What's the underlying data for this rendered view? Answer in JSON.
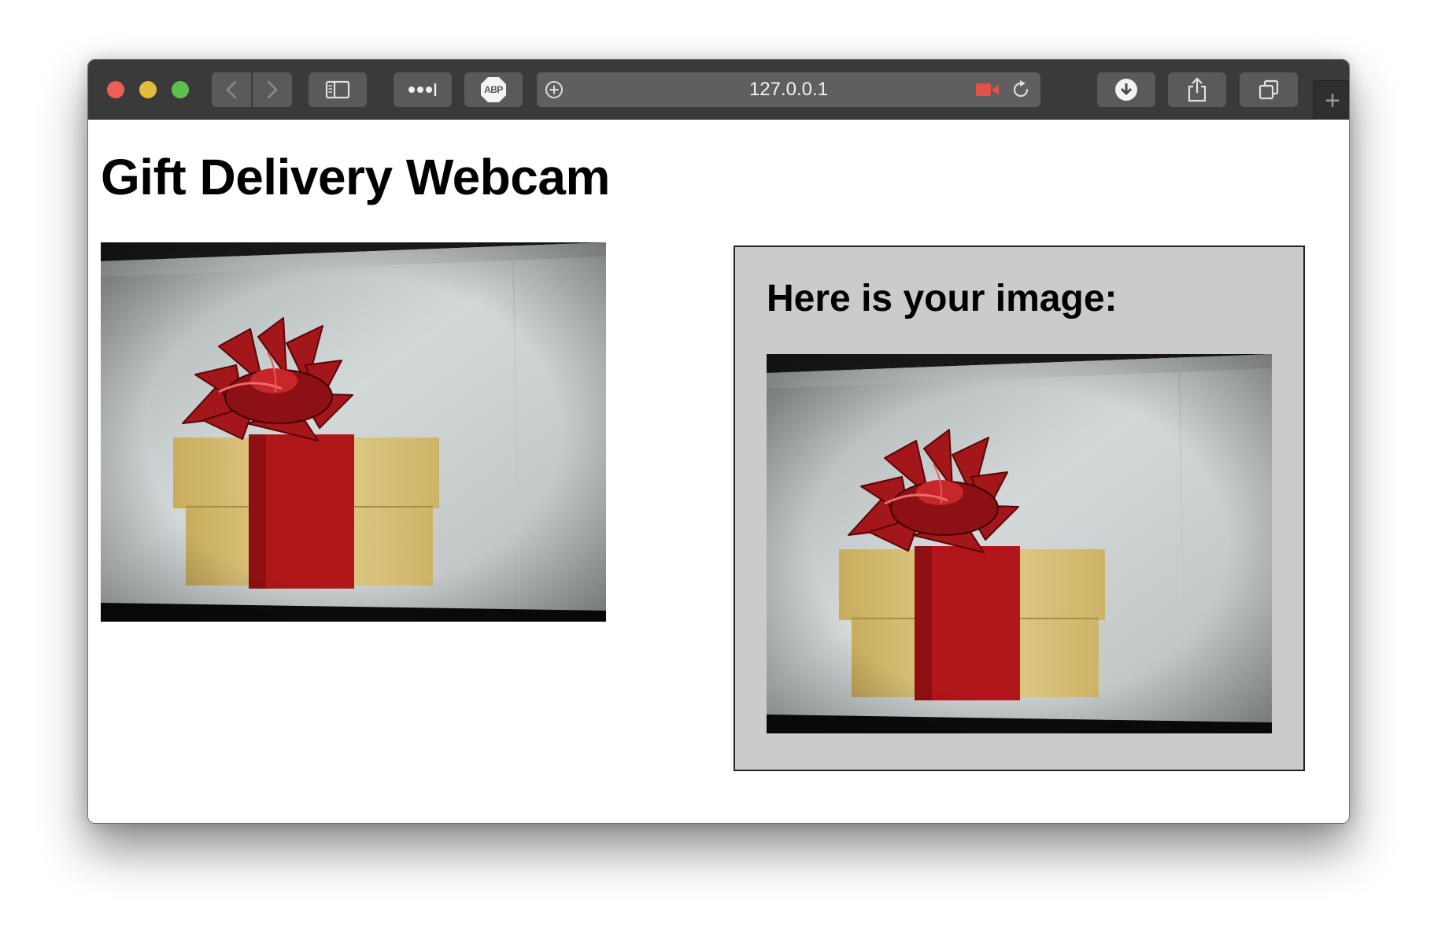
{
  "browser": {
    "address": "127.0.0.1",
    "new_tab_symbol": "+",
    "toolbar_icons": [
      "back-icon",
      "forward-icon",
      "sidebar-icon",
      "reader-icon",
      "adblock-icon",
      "add-icon",
      "camera-icon",
      "reload-icon",
      "download-icon",
      "share-icon",
      "tabs-icon"
    ],
    "adblock_badge": "ABP"
  },
  "page": {
    "title": "Gift Delivery Webcam",
    "result_heading": "Here is your image:"
  },
  "colors": {
    "traffic_red": "#ec5f57",
    "traffic_yellow": "#e1bc3f",
    "traffic_green": "#5fc04c",
    "result_box_bg": "#cbcbcb",
    "ribbon_red": "#b0171a",
    "box_yellow": "#d8c07a"
  }
}
